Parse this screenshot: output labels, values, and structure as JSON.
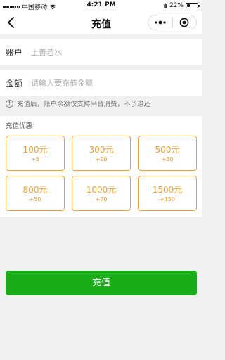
{
  "status_bar": {
    "carrier": "中国移动",
    "time": "4:21 PM",
    "battery": "22%",
    "battery_level": 0.22
  },
  "nav": {
    "title": "充值"
  },
  "account": {
    "label": "账户",
    "value": "上善若水"
  },
  "amount": {
    "label": "金额",
    "placeholder": "请输入要充值金额",
    "value": ""
  },
  "notice": "充值后，账户余额仅支持平台消费，不予退还",
  "offers": {
    "title": "充值优惠",
    "items": [
      {
        "amount": "100元",
        "bonus": "+5"
      },
      {
        "amount": "300元",
        "bonus": "+20"
      },
      {
        "amount": "500元",
        "bonus": "+30"
      },
      {
        "amount": "800元",
        "bonus": "+50"
      },
      {
        "amount": "1000元",
        "bonus": "+70"
      },
      {
        "amount": "1500元",
        "bonus": "+150"
      }
    ]
  },
  "submit_label": "充值",
  "colors": {
    "accent": "#f0a030",
    "primary": "#1aad19"
  }
}
